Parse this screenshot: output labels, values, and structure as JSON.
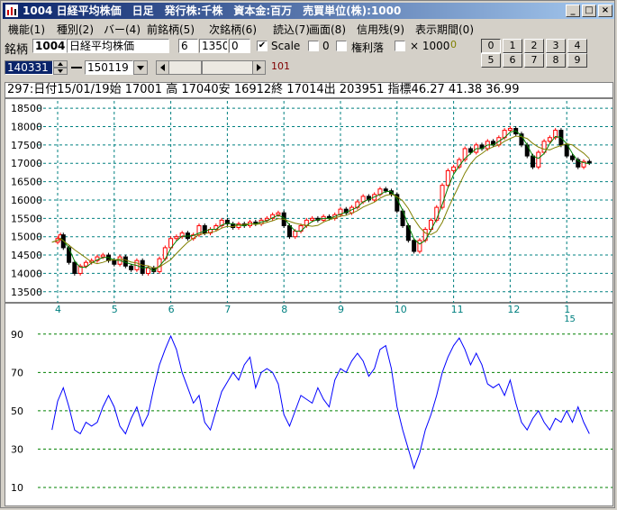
{
  "window": {
    "title": "1004 日経平均株価　日足　発行株:千株　資本金:百万　売買単位(株):1000",
    "buttons": [
      "_",
      "□",
      "×"
    ]
  },
  "menu": [
    "機能(1)",
    "種別(2)",
    "バー(4)",
    "前銘柄(5)",
    "次銘柄(6)",
    "読込(7)",
    "画面(8)",
    "信用残(9)",
    "表示期間(0)"
  ],
  "toolbar": {
    "symbol_label": "銘柄",
    "symbol_code": "1004",
    "symbol_name": "日経平均株価",
    "field_a": "6",
    "field_b": "1350",
    "field_c": "0",
    "scale_label": "Scale",
    "scale_checked": "✔",
    "zero_label": "0",
    "rights_label": "権利落",
    "times_label": "× 1000",
    "tiny_value": "0",
    "start_date": "140331",
    "end_date": "150119",
    "scroll_value": "101",
    "preset_buttons": [
      "0",
      "1",
      "2",
      "3",
      "4",
      "5",
      "6",
      "7",
      "8",
      "9"
    ]
  },
  "info": {
    "text": "297:日付15/01/19始 17001 高 17040安 16912終 17014出 203951 指標46.27   41.38   36.99"
  },
  "chart_data": [
    {
      "type": "candlestick",
      "ylim": [
        13200,
        18700
      ],
      "yticks": [
        13500,
        14000,
        14500,
        15000,
        15500,
        16000,
        16500,
        17000,
        17500,
        18000,
        18500
      ],
      "xticks": [
        {
          "label": "4",
          "t": 0.0
        },
        {
          "label": "5",
          "t": 1.0
        },
        {
          "label": "6",
          "t": 2.0
        },
        {
          "label": "7",
          "t": 3.0
        },
        {
          "label": "8",
          "t": 4.0
        },
        {
          "label": "9",
          "t": 5.0
        },
        {
          "label": "10",
          "t": 6.0
        },
        {
          "label": "11",
          "t": 7.0
        },
        {
          "label": "12",
          "t": 8.0
        },
        {
          "label": "1",
          "t": 9.0
        }
      ],
      "year_label": "15",
      "grid": true,
      "close_series": [
        [
          -0.1,
          14850
        ],
        [
          0.0,
          14950
        ],
        [
          0.05,
          15050
        ],
        [
          0.1,
          14700
        ],
        [
          0.2,
          14300
        ],
        [
          0.3,
          14000
        ],
        [
          0.4,
          14200
        ],
        [
          0.5,
          14300
        ],
        [
          0.6,
          14350
        ],
        [
          0.7,
          14450
        ],
        [
          0.8,
          14500
        ],
        [
          0.9,
          14350
        ],
        [
          1.0,
          14250
        ],
        [
          1.1,
          14450
        ],
        [
          1.2,
          14200
        ],
        [
          1.3,
          14100
        ],
        [
          1.4,
          14350
        ],
        [
          1.5,
          14000
        ],
        [
          1.6,
          14150
        ],
        [
          1.7,
          14050
        ],
        [
          1.8,
          14400
        ],
        [
          1.9,
          14700
        ],
        [
          2.0,
          14950
        ],
        [
          2.1,
          15000
        ],
        [
          2.2,
          15100
        ],
        [
          2.3,
          14950
        ],
        [
          2.4,
          15050
        ],
        [
          2.5,
          15300
        ],
        [
          2.6,
          15100
        ],
        [
          2.7,
          15200
        ],
        [
          2.8,
          15300
        ],
        [
          2.9,
          15450
        ],
        [
          3.0,
          15350
        ],
        [
          3.1,
          15250
        ],
        [
          3.2,
          15350
        ],
        [
          3.3,
          15300
        ],
        [
          3.4,
          15400
        ],
        [
          3.5,
          15350
        ],
        [
          3.6,
          15450
        ],
        [
          3.7,
          15500
        ],
        [
          3.8,
          15600
        ],
        [
          3.9,
          15650
        ],
        [
          4.0,
          15300
        ],
        [
          4.1,
          15000
        ],
        [
          4.2,
          15150
        ],
        [
          4.3,
          15300
        ],
        [
          4.4,
          15450
        ],
        [
          4.5,
          15500
        ],
        [
          4.6,
          15450
        ],
        [
          4.7,
          15550
        ],
        [
          4.8,
          15500
        ],
        [
          4.9,
          15600
        ],
        [
          5.0,
          15750
        ],
        [
          5.1,
          15650
        ],
        [
          5.2,
          15800
        ],
        [
          5.3,
          15950
        ],
        [
          5.4,
          16100
        ],
        [
          5.5,
          16000
        ],
        [
          5.6,
          16150
        ],
        [
          5.7,
          16300
        ],
        [
          5.8,
          16250
        ],
        [
          5.9,
          16150
        ],
        [
          6.0,
          15700
        ],
        [
          6.1,
          15300
        ],
        [
          6.2,
          14900
        ],
        [
          6.3,
          14600
        ],
        [
          6.4,
          14900
        ],
        [
          6.5,
          15200
        ],
        [
          6.6,
          15450
        ],
        [
          6.7,
          15800
        ],
        [
          6.8,
          16400
        ],
        [
          6.9,
          16800
        ],
        [
          7.0,
          16900
        ],
        [
          7.1,
          17100
        ],
        [
          7.2,
          17400
        ],
        [
          7.3,
          17300
        ],
        [
          7.4,
          17500
        ],
        [
          7.5,
          17400
        ],
        [
          7.6,
          17600
        ],
        [
          7.7,
          17500
        ],
        [
          7.8,
          17700
        ],
        [
          7.9,
          17900
        ],
        [
          8.0,
          17950
        ],
        [
          8.1,
          17800
        ],
        [
          8.2,
          17500
        ],
        [
          8.3,
          17200
        ],
        [
          8.4,
          16900
        ],
        [
          8.5,
          17300
        ],
        [
          8.6,
          17600
        ],
        [
          8.7,
          17700
        ],
        [
          8.8,
          17900
        ],
        [
          8.9,
          17500
        ],
        [
          9.0,
          17200
        ],
        [
          9.1,
          17100
        ],
        [
          9.2,
          16900
        ],
        [
          9.3,
          17050
        ],
        [
          9.4,
          17014
        ]
      ]
    },
    {
      "type": "line",
      "ylim": [
        2,
        96
      ],
      "yticks": [
        10,
        30,
        50,
        70,
        90
      ],
      "grid": true,
      "series": [
        {
          "values": [
            [
              -0.1,
              40
            ],
            [
              0.0,
              55
            ],
            [
              0.1,
              62
            ],
            [
              0.2,
              52
            ],
            [
              0.3,
              40
            ],
            [
              0.4,
              38
            ],
            [
              0.5,
              44
            ],
            [
              0.6,
              42
            ],
            [
              0.7,
              44
            ],
            [
              0.8,
              52
            ],
            [
              0.9,
              58
            ],
            [
              1.0,
              52
            ],
            [
              1.1,
              42
            ],
            [
              1.2,
              38
            ],
            [
              1.3,
              46
            ],
            [
              1.4,
              52
            ],
            [
              1.5,
              42
            ],
            [
              1.6,
              48
            ],
            [
              1.7,
              62
            ],
            [
              1.8,
              74
            ],
            [
              1.9,
              82
            ],
            [
              2.0,
              89
            ],
            [
              2.1,
              82
            ],
            [
              2.2,
              70
            ],
            [
              2.3,
              62
            ],
            [
              2.4,
              54
            ],
            [
              2.5,
              58
            ],
            [
              2.6,
              44
            ],
            [
              2.7,
              40
            ],
            [
              2.8,
              50
            ],
            [
              2.9,
              60
            ],
            [
              3.0,
              65
            ],
            [
              3.1,
              70
            ],
            [
              3.2,
              66
            ],
            [
              3.3,
              74
            ],
            [
              3.4,
              78
            ],
            [
              3.5,
              62
            ],
            [
              3.6,
              70
            ],
            [
              3.7,
              72
            ],
            [
              3.8,
              70
            ],
            [
              3.9,
              64
            ],
            [
              4.0,
              48
            ],
            [
              4.1,
              42
            ],
            [
              4.2,
              50
            ],
            [
              4.3,
              58
            ],
            [
              4.4,
              56
            ],
            [
              4.5,
              54
            ],
            [
              4.6,
              62
            ],
            [
              4.7,
              56
            ],
            [
              4.8,
              52
            ],
            [
              4.9,
              66
            ],
            [
              5.0,
              72
            ],
            [
              5.1,
              70
            ],
            [
              5.2,
              76
            ],
            [
              5.3,
              80
            ],
            [
              5.4,
              76
            ],
            [
              5.5,
              68
            ],
            [
              5.6,
              72
            ],
            [
              5.7,
              82
            ],
            [
              5.8,
              84
            ],
            [
              5.9,
              72
            ],
            [
              6.0,
              52
            ],
            [
              6.1,
              40
            ],
            [
              6.2,
              30
            ],
            [
              6.3,
              20
            ],
            [
              6.4,
              28
            ],
            [
              6.5,
              40
            ],
            [
              6.6,
              48
            ],
            [
              6.7,
              58
            ],
            [
              6.8,
              70
            ],
            [
              6.9,
              78
            ],
            [
              7.0,
              84
            ],
            [
              7.1,
              88
            ],
            [
              7.2,
              82
            ],
            [
              7.3,
              74
            ],
            [
              7.4,
              80
            ],
            [
              7.5,
              74
            ],
            [
              7.6,
              64
            ],
            [
              7.7,
              62
            ],
            [
              7.8,
              64
            ],
            [
              7.9,
              58
            ],
            [
              8.0,
              66
            ],
            [
              8.1,
              54
            ],
            [
              8.2,
              44
            ],
            [
              8.3,
              40
            ],
            [
              8.4,
              46
            ],
            [
              8.5,
              50
            ],
            [
              8.6,
              44
            ],
            [
              8.7,
              40
            ],
            [
              8.8,
              46
            ],
            [
              8.9,
              44
            ],
            [
              9.0,
              50
            ],
            [
              9.1,
              44
            ],
            [
              9.2,
              52
            ],
            [
              9.3,
              44
            ],
            [
              9.4,
              38
            ]
          ]
        }
      ]
    }
  ],
  "colors": {
    "window_bg": "#d4d0c8",
    "title_start": "#0a246a",
    "title_end": "#a6caf0",
    "grid": "#008080",
    "candle_down": "#000000",
    "candle_up": "#ff0000",
    "ma_short": "#008000",
    "ma_long": "#808000",
    "indicator": "#0000ff",
    "field_selected": "#0a246a"
  }
}
